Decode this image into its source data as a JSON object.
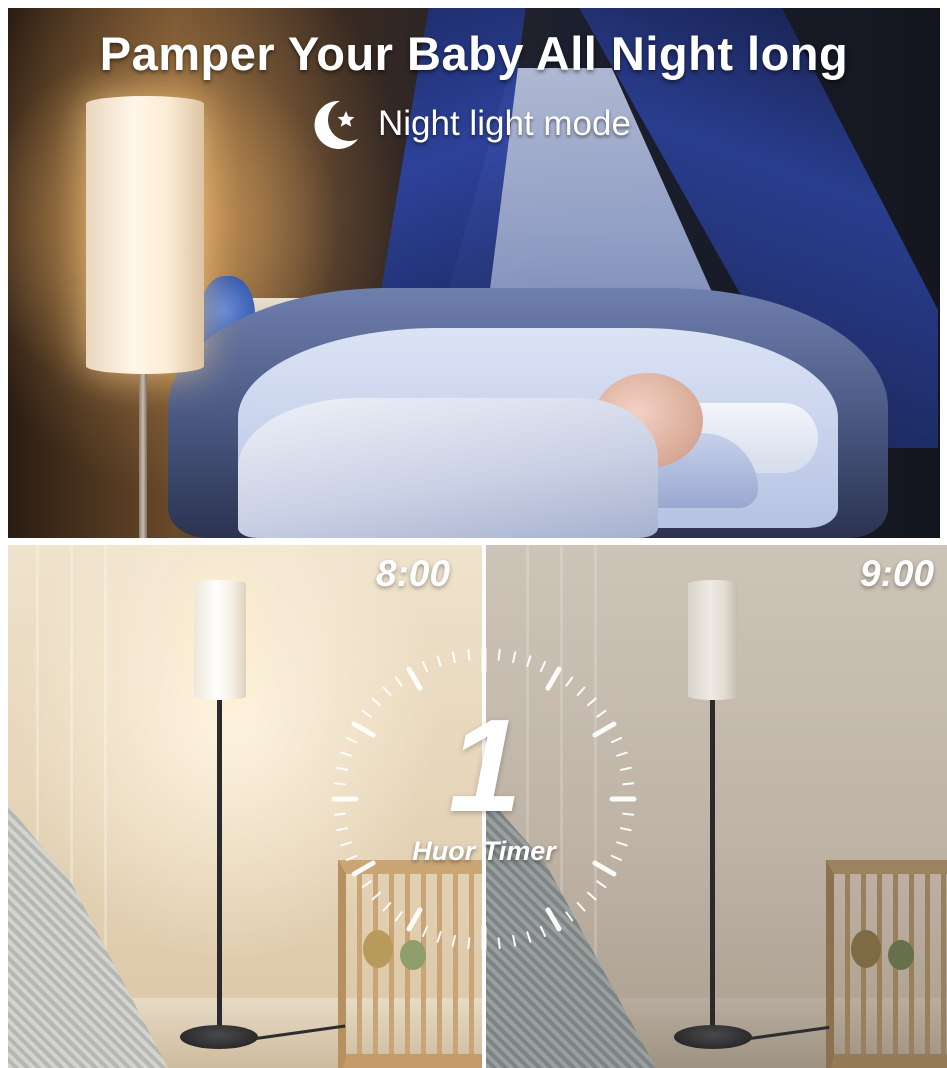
{
  "top_banner": {
    "headline": "Pamper Your Baby All Night long",
    "mode_label": "Night light mode",
    "mode_icon": "moon-star-icon"
  },
  "timer_comparison": {
    "start_time": "8:00",
    "end_time": "9:00",
    "timer_hours": "1",
    "timer_caption": "Huor Timer"
  },
  "colors": {
    "text": "#ffffff",
    "warm_light": "#fff3dc",
    "canopy_blue": "#2d43a0"
  }
}
